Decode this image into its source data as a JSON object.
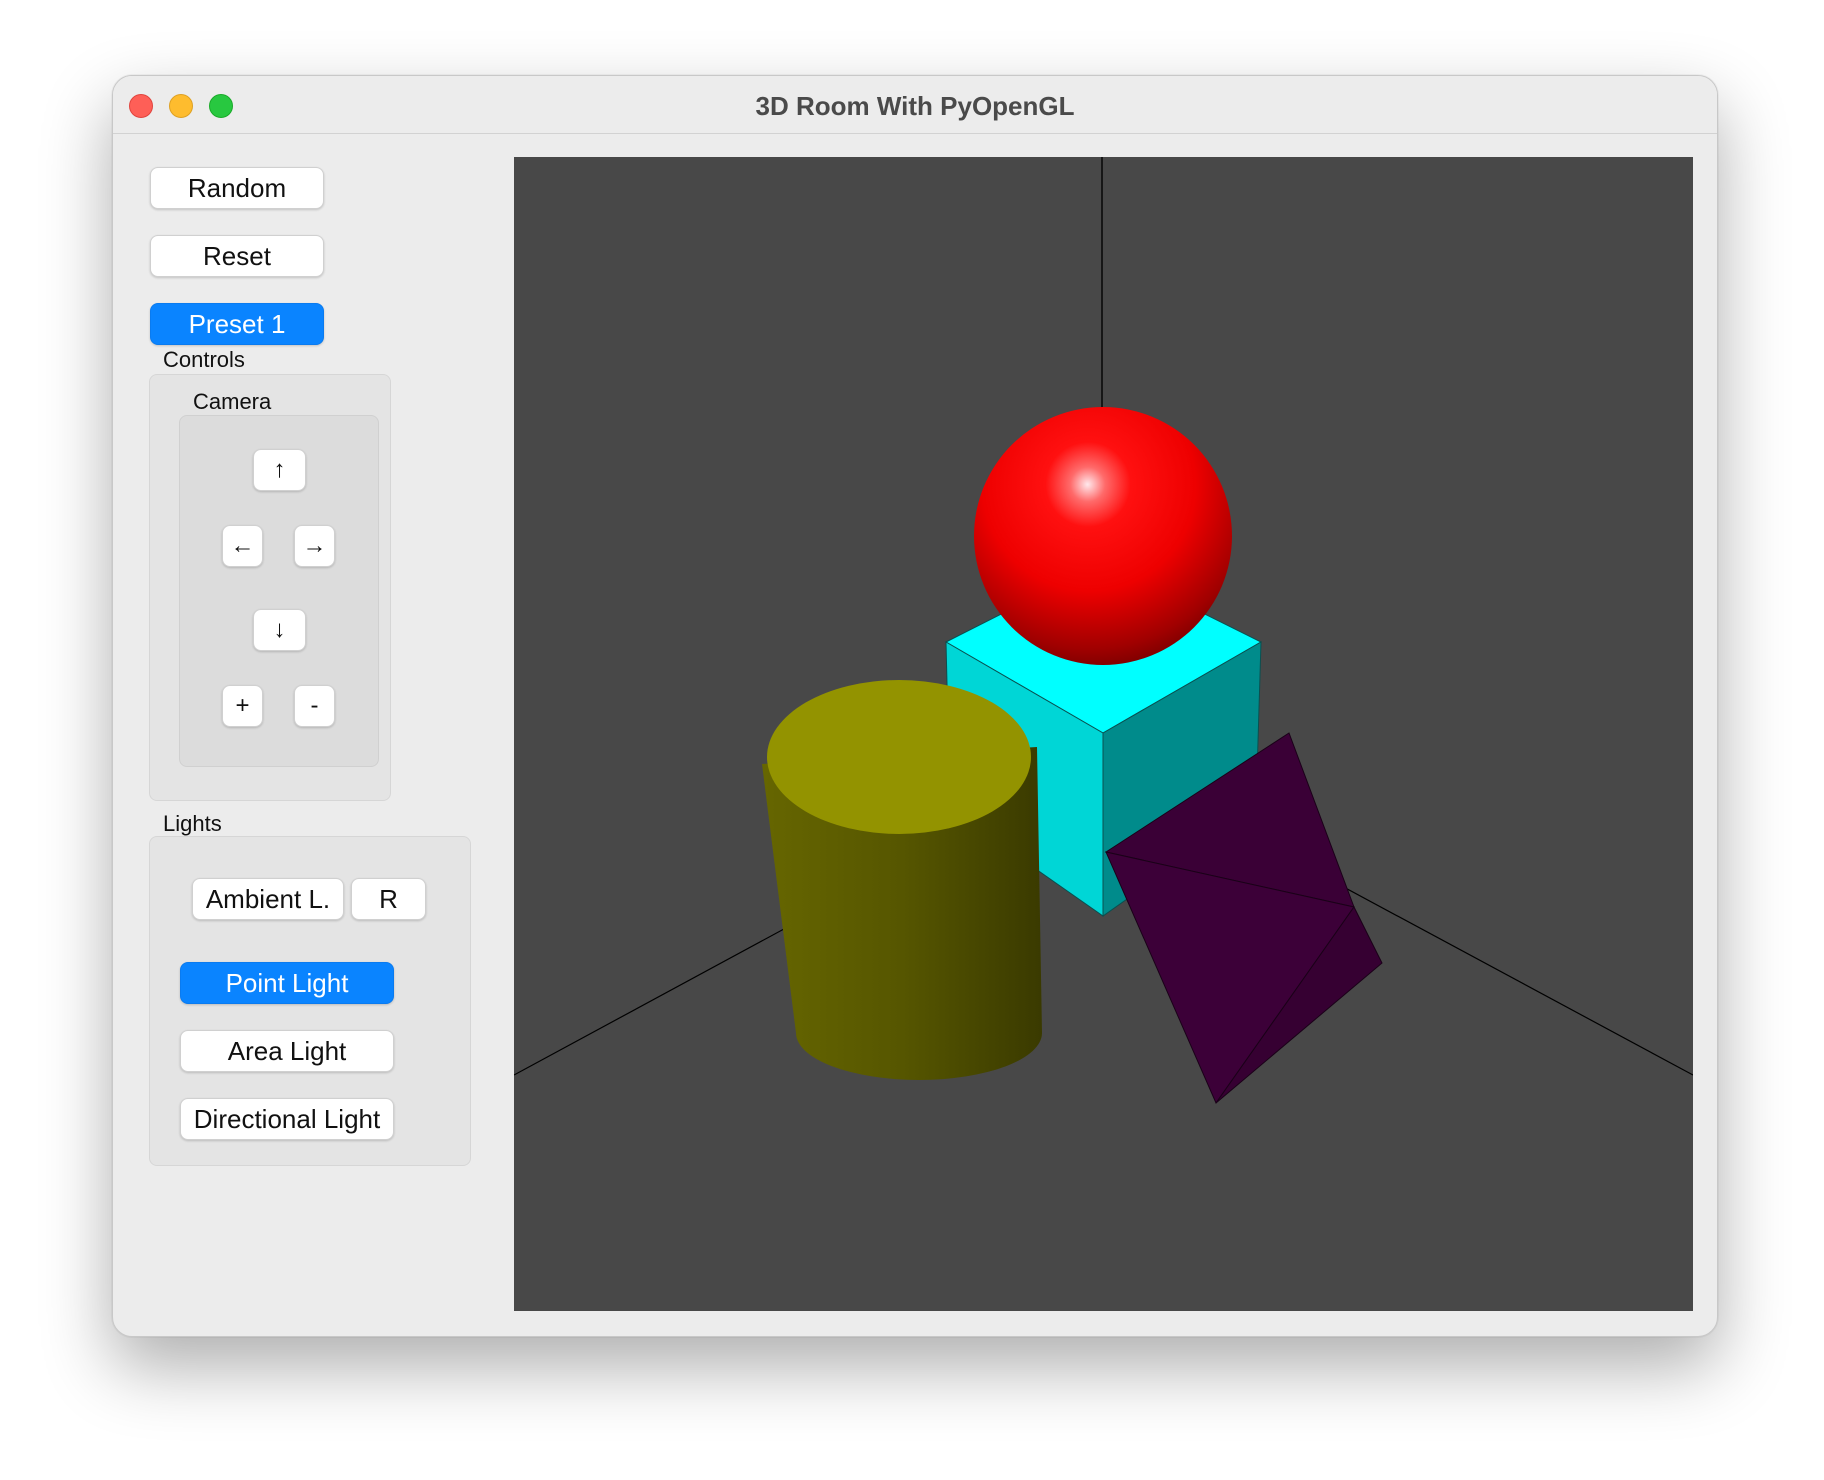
{
  "window": {
    "title": "3D Room With PyOpenGL"
  },
  "sidebar": {
    "random_label": "Random",
    "reset_label": "Reset",
    "preset_label": "Preset 1",
    "controls_label": "Controls",
    "camera": {
      "label": "Camera",
      "up_label": "↑",
      "left_label": "←",
      "right_label": "→",
      "down_label": "↓",
      "zoom_in_label": "+",
      "zoom_out_label": "-"
    },
    "lights": {
      "label": "Lights",
      "ambient_label": "Ambient L.",
      "ambient_reset_label": "R",
      "point_label": "Point Light",
      "area_label": "Area Light",
      "directional_label": "Directional Light"
    }
  },
  "scene": {
    "background_color": "#484848",
    "objects": [
      {
        "name": "sphere",
        "color": "#ff0000"
      },
      {
        "name": "cube",
        "color": "#00ffff"
      },
      {
        "name": "cylinder",
        "color": "#939300"
      },
      {
        "name": "tetrahedron",
        "color": "#3c0038"
      }
    ]
  },
  "accent_color": "#0a84ff"
}
